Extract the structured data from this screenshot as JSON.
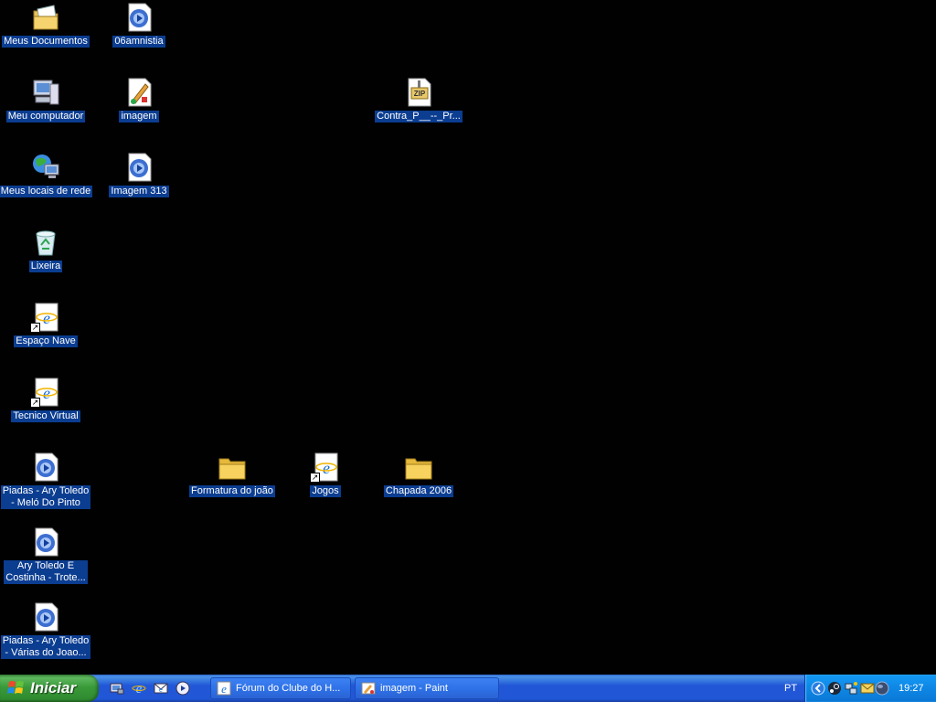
{
  "desktop": {
    "icons": [
      {
        "label": "Meus Documentos",
        "icon": "my-documents-icon"
      },
      {
        "label": "06amnistia",
        "icon": "media-file-icon"
      },
      {
        "label": "Meu computador",
        "icon": "my-computer-icon"
      },
      {
        "label": "imagem",
        "icon": "paint-image-icon"
      },
      {
        "label": "Contra_P__--_Pr...",
        "icon": "zip-file-icon"
      },
      {
        "label": "Meus locais de rede",
        "icon": "network-places-icon"
      },
      {
        "label": "Imagem 313",
        "icon": "media-file-icon"
      },
      {
        "label": "Lixeira",
        "icon": "recycle-bin-icon"
      },
      {
        "label": "Espaço Nave",
        "icon": "internet-shortcut-icon"
      },
      {
        "label": "Tecnico Virtual",
        "icon": "internet-shortcut-icon"
      },
      {
        "label": "Piadas - Ary Toledo\n- Meló Do Pinto",
        "icon": "media-file-icon"
      },
      {
        "label": "Formatura do joão",
        "icon": "folder-icon"
      },
      {
        "label": "Jogos",
        "icon": "internet-shortcut-icon"
      },
      {
        "label": "Chapada 2006",
        "icon": "folder-icon"
      },
      {
        "label": "Ary Toledo E\nCostinha - Trote...",
        "icon": "media-file-icon"
      },
      {
        "label": "Piadas - Ary Toledo\n- Várias do Joao...",
        "icon": "media-file-icon"
      }
    ]
  },
  "taskbar": {
    "start_label": "Iniciar",
    "quick_launch": [
      "show-desktop-icon",
      "internet-explorer-icon",
      "outlook-express-icon",
      "media-player-icon"
    ],
    "tasks": [
      {
        "label": "Fórum do Clube do H...",
        "icon": "internet-explorer-icon"
      },
      {
        "label": "imagem - Paint",
        "icon": "paint-icon"
      }
    ],
    "language": "PT",
    "clock": "19:27"
  },
  "colors": {
    "desktop_bg": "#010101",
    "label_highlight": "#0b3d91",
    "taskbar_blue": "#2157d7",
    "start_green": "#3a9a3a",
    "tray_blue": "#0f8ae8"
  }
}
